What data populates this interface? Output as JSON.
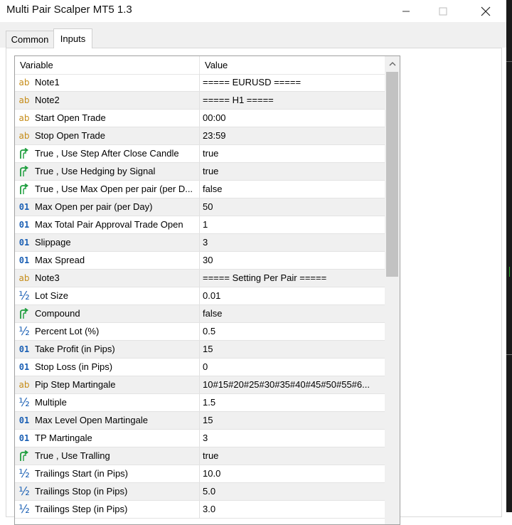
{
  "window": {
    "title": "Multi Pair Scalper MT5 1.3"
  },
  "tabs": [
    {
      "label": "Common"
    },
    {
      "label": "Inputs"
    }
  ],
  "grid": {
    "columns": {
      "variable": "Variable",
      "value": "Value"
    },
    "rows": [
      {
        "icon": "string-icon",
        "name": "Note1",
        "value": "===== EURUSD ====="
      },
      {
        "icon": "string-icon",
        "name": "Note2",
        "value": "===== H1 ====="
      },
      {
        "icon": "string-icon",
        "name": "Start Open Trade",
        "value": "00:00"
      },
      {
        "icon": "string-icon",
        "name": "Stop Open Trade",
        "value": "23:59"
      },
      {
        "icon": "bool-icon",
        "name": "True , Use Step After Close Candle",
        "value": "true"
      },
      {
        "icon": "bool-icon",
        "name": "True , Use Hedging by Signal",
        "value": "true"
      },
      {
        "icon": "bool-icon",
        "name": "True , Use Max Open per pair (per D...",
        "value": "false"
      },
      {
        "icon": "integer-icon",
        "name": "Max Open per pair (per Day)",
        "value": "50"
      },
      {
        "icon": "integer-icon",
        "name": "Max Total Pair Approval Trade Open",
        "value": "1"
      },
      {
        "icon": "integer-icon",
        "name": "Slippage",
        "value": "3"
      },
      {
        "icon": "integer-icon",
        "name": "Max Spread",
        "value": "30"
      },
      {
        "icon": "string-icon",
        "name": "Note3",
        "value": "===== Setting Per Pair ====="
      },
      {
        "icon": "double-icon",
        "name": "Lot Size",
        "value": "0.01"
      },
      {
        "icon": "bool-icon",
        "name": "Compound",
        "value": "false"
      },
      {
        "icon": "double-icon",
        "name": "Percent Lot (%)",
        "value": "0.5"
      },
      {
        "icon": "integer-icon",
        "name": "Take Profit (in Pips)",
        "value": "15"
      },
      {
        "icon": "integer-icon",
        "name": "Stop Loss (in Pips)",
        "value": "0"
      },
      {
        "icon": "string-icon",
        "name": "Pip Step Martingale",
        "value": "10#15#20#25#30#35#40#45#50#55#6..."
      },
      {
        "icon": "double-icon",
        "name": "Multiple",
        "value": "1.5"
      },
      {
        "icon": "integer-icon",
        "name": "Max Level Open Martingale",
        "value": "15"
      },
      {
        "icon": "integer-icon",
        "name": "TP Martingale",
        "value": "3"
      },
      {
        "icon": "bool-icon",
        "name": "True , Use Tralling",
        "value": "true"
      },
      {
        "icon": "double-icon",
        "name": "Trailings Start (in Pips)",
        "value": "10.0"
      },
      {
        "icon": "double-icon",
        "name": "Trailings Stop  (in Pips)",
        "value": "5.0"
      },
      {
        "icon": "double-icon",
        "name": "Trailings Step  (in Pips)",
        "value": "3.0"
      }
    ]
  },
  "colors": {
    "string_icon": "#c58b16",
    "integer_icon": "#1a5fb4",
    "bool_icon": "#1e9e3e",
    "alt_row": "#f0f0f0"
  }
}
